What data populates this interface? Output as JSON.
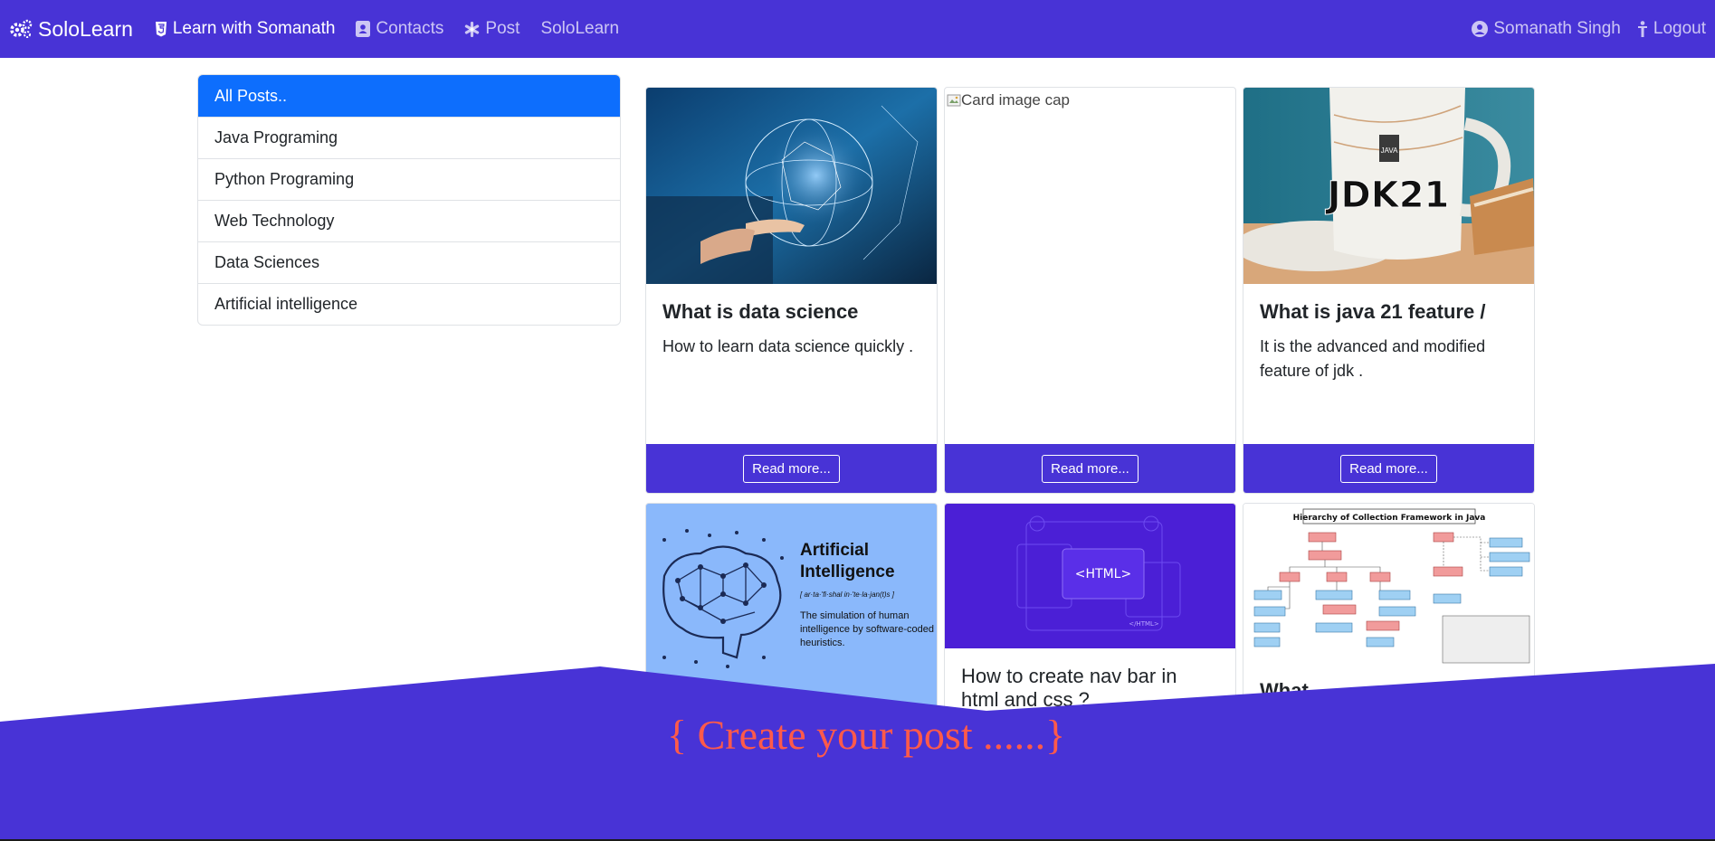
{
  "navbar": {
    "brand": "SoloLearn",
    "links": [
      {
        "label": "Learn with Somanath",
        "icon": "html5-icon"
      },
      {
        "label": "Contacts",
        "icon": "contact-book-icon"
      },
      {
        "label": "Post",
        "icon": "asterisk-icon"
      },
      {
        "label": "SoloLearn",
        "icon": ""
      }
    ],
    "user": "Somanath Singh",
    "logout": "Logout"
  },
  "sidebar": {
    "items": [
      {
        "label": "All Posts.."
      },
      {
        "label": "Java Programing"
      },
      {
        "label": "Python Programing"
      },
      {
        "label": "Web Technology"
      },
      {
        "label": "Data Sciences"
      },
      {
        "label": "Artificial intelligence"
      }
    ]
  },
  "cards": [
    {
      "title": "What is data science",
      "text": "How to learn data science quickly .",
      "button": "Read more..."
    },
    {
      "img_alt": "Card image cap",
      "button": "Read more..."
    },
    {
      "title": "What is java 21 feature /",
      "text": "It is the advanced and modified feature of jdk .",
      "button": "Read more...",
      "img_caption": "JDK21",
      "cup_label": "JAVA"
    },
    {
      "img_heading": "Artificial Intelligence",
      "img_phonetic": "[ ar·ta·'fi·shal in·'te·la·jan(t)s ]",
      "img_desc": "The simulation of human intelligence by software-coded heuristics."
    },
    {
      "title": "How to create nav bar in html and css ?",
      "img_tag": "<HTML>",
      "img_tag_small": "</HTML>"
    },
    {
      "title": "What",
      "img_heading": "Hierarchy of Collection Framework in Java"
    }
  ],
  "banner": {
    "text": "{ Create your post ......}"
  },
  "colors": {
    "primary": "#4833d6",
    "active": "#0d6efd",
    "banner_text": "#ff5a4a"
  }
}
